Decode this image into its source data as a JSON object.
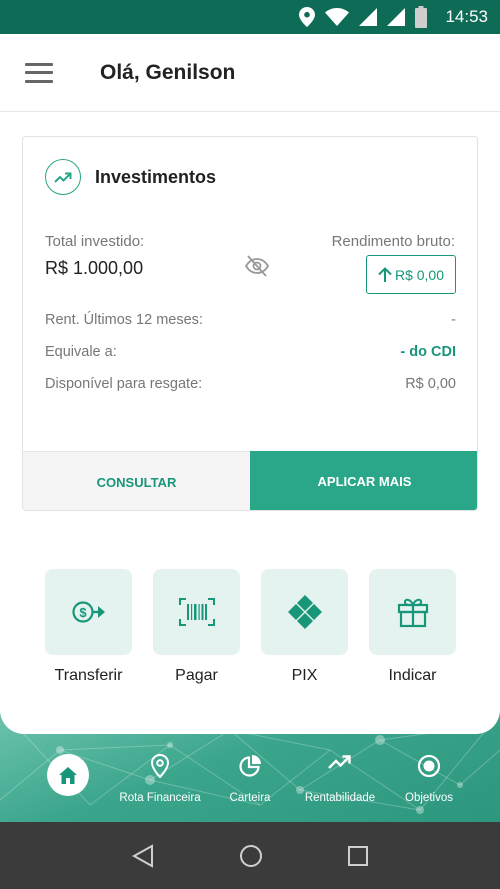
{
  "status_bar": {
    "time": "14:53",
    "icons": [
      "location-icon",
      "wifi-icon",
      "signal-icon",
      "signal-icon",
      "battery-icon"
    ]
  },
  "header": {
    "greeting": "Olá, Genilson",
    "menu_icon": "hamburger-menu-icon"
  },
  "investments": {
    "title": "Investimentos",
    "total_label": "Total investido:",
    "total_value": "R$ 1.000,00",
    "rendimento_label": "Rendimento bruto:",
    "rendimento_value": "R$ 0,00",
    "rows": [
      {
        "label": "Rent. Últimos 12 meses:",
        "value": "-"
      },
      {
        "label": "Equivale a:",
        "value": "- do CDI"
      },
      {
        "label": "Disponível para resgate:",
        "value": "R$ 0,00"
      }
    ],
    "consultar_label": "CONSULTAR",
    "aplicar_label": "APLICAR MAIS"
  },
  "actions": [
    {
      "label": "Transferir",
      "icon": "transfer-money-icon"
    },
    {
      "label": "Pagar",
      "icon": "barcode-icon"
    },
    {
      "label": "PIX",
      "icon": "pix-icon"
    },
    {
      "label": "Indicar",
      "icon": "gift-icon"
    }
  ],
  "bottom_nav": [
    {
      "label": "",
      "icon": "home-icon"
    },
    {
      "label": "Rota Financeira",
      "icon": "map-pin-icon"
    },
    {
      "label": "Carteira",
      "icon": "pie-chart-icon"
    },
    {
      "label": "Rentabilidade",
      "icon": "trending-up-icon"
    },
    {
      "label": "Objetivos",
      "icon": "target-icon"
    }
  ],
  "colors": {
    "primary": "#2aa688",
    "dark_green": "#0d6b56",
    "accent_text": "#17967a",
    "tile_bg": "#e4f3ef"
  }
}
